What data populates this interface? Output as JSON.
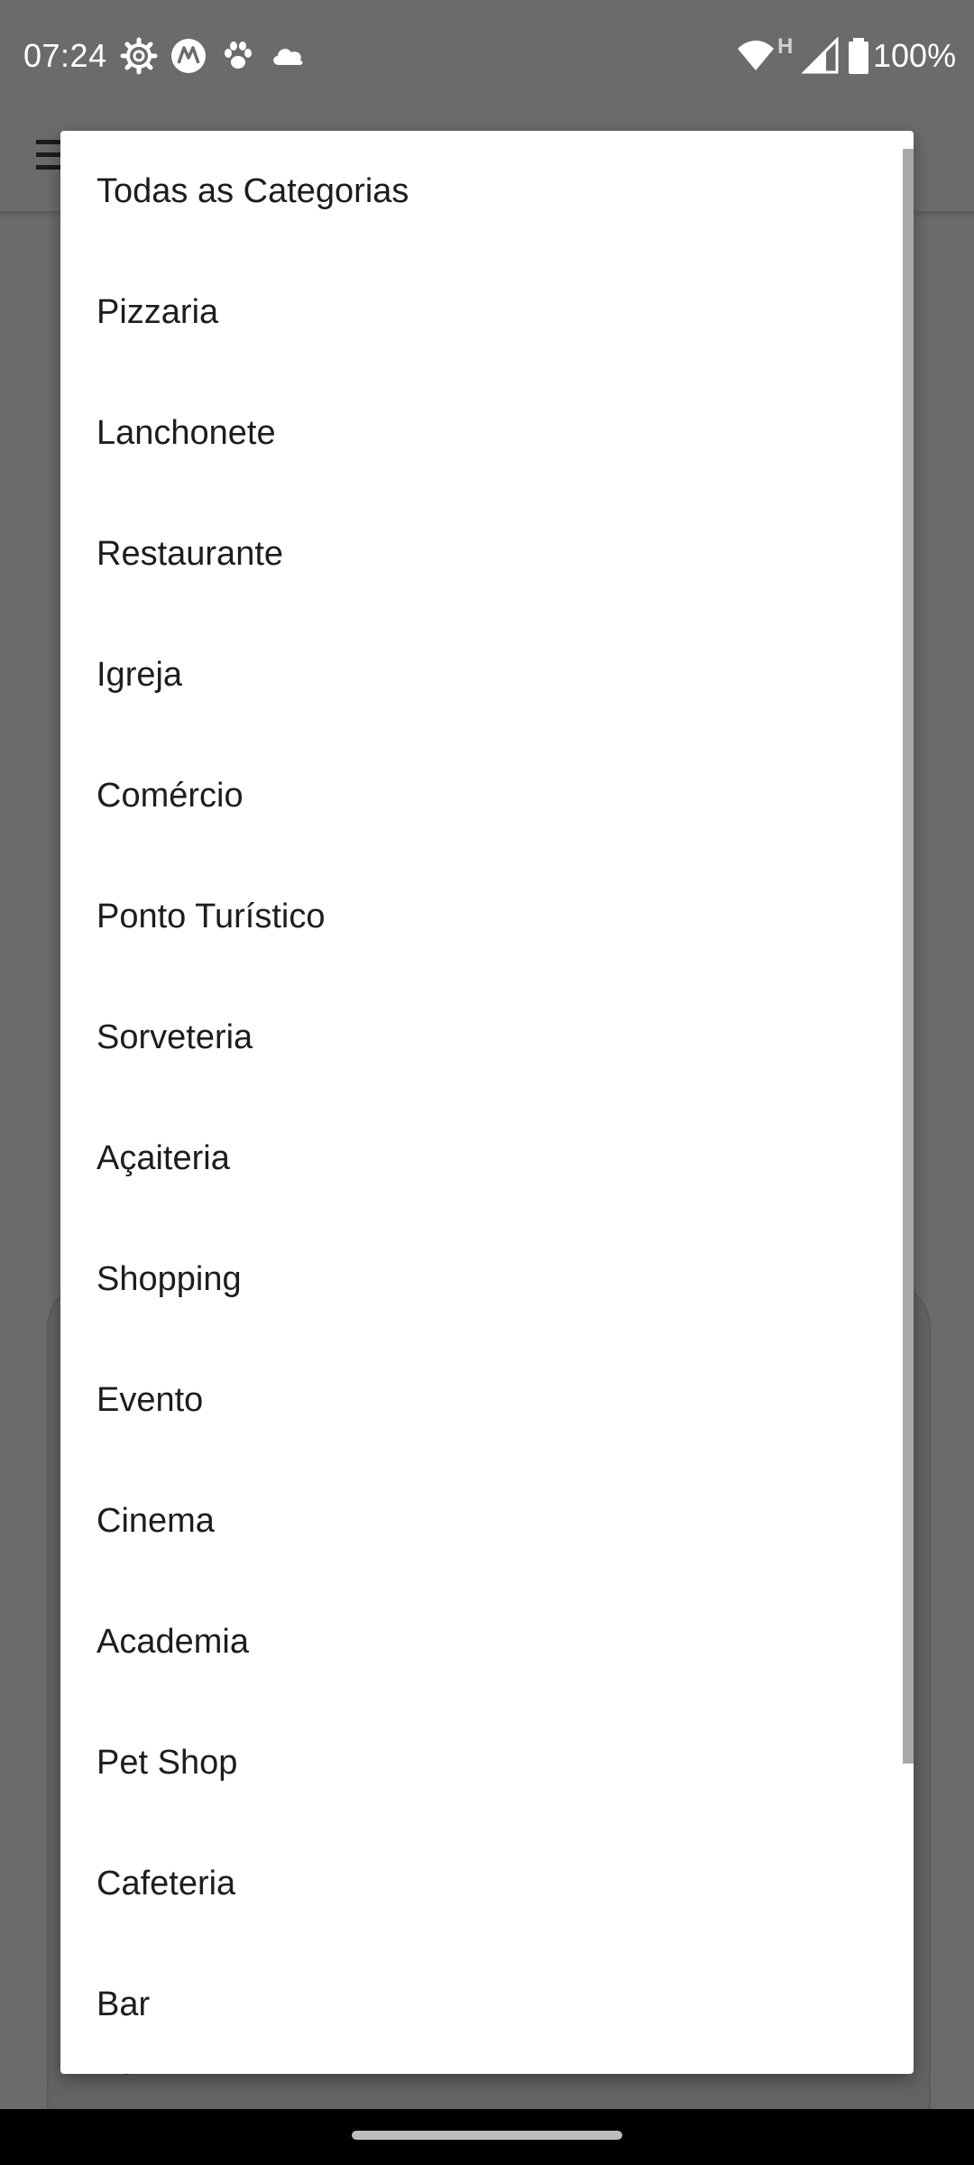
{
  "status_bar": {
    "time": "07:24",
    "battery": "100%",
    "network_letter": "H",
    "left_icons": [
      "gear-icon",
      "motorola-icon",
      "paw-icon",
      "cloud-icon"
    ],
    "right_icons": [
      "wifi-icon",
      "signal-icon",
      "battery-icon"
    ]
  },
  "dialog": {
    "options": [
      "Todas as Categorias",
      "Pizzaria",
      "Lanchonete",
      "Restaurante",
      "Igreja",
      "Comércio",
      "Ponto Turístico",
      "Sorveteria",
      "Açaiteria",
      "Shopping",
      "Evento",
      "Cinema",
      "Academia",
      "Pet Shop",
      "Cafeteria",
      "Bar"
    ]
  },
  "colors": {
    "scrim": "#6b6b6b",
    "dialog_bg": "#ffffff",
    "text": "#1d1d1d",
    "nav_bar": "#000000"
  }
}
